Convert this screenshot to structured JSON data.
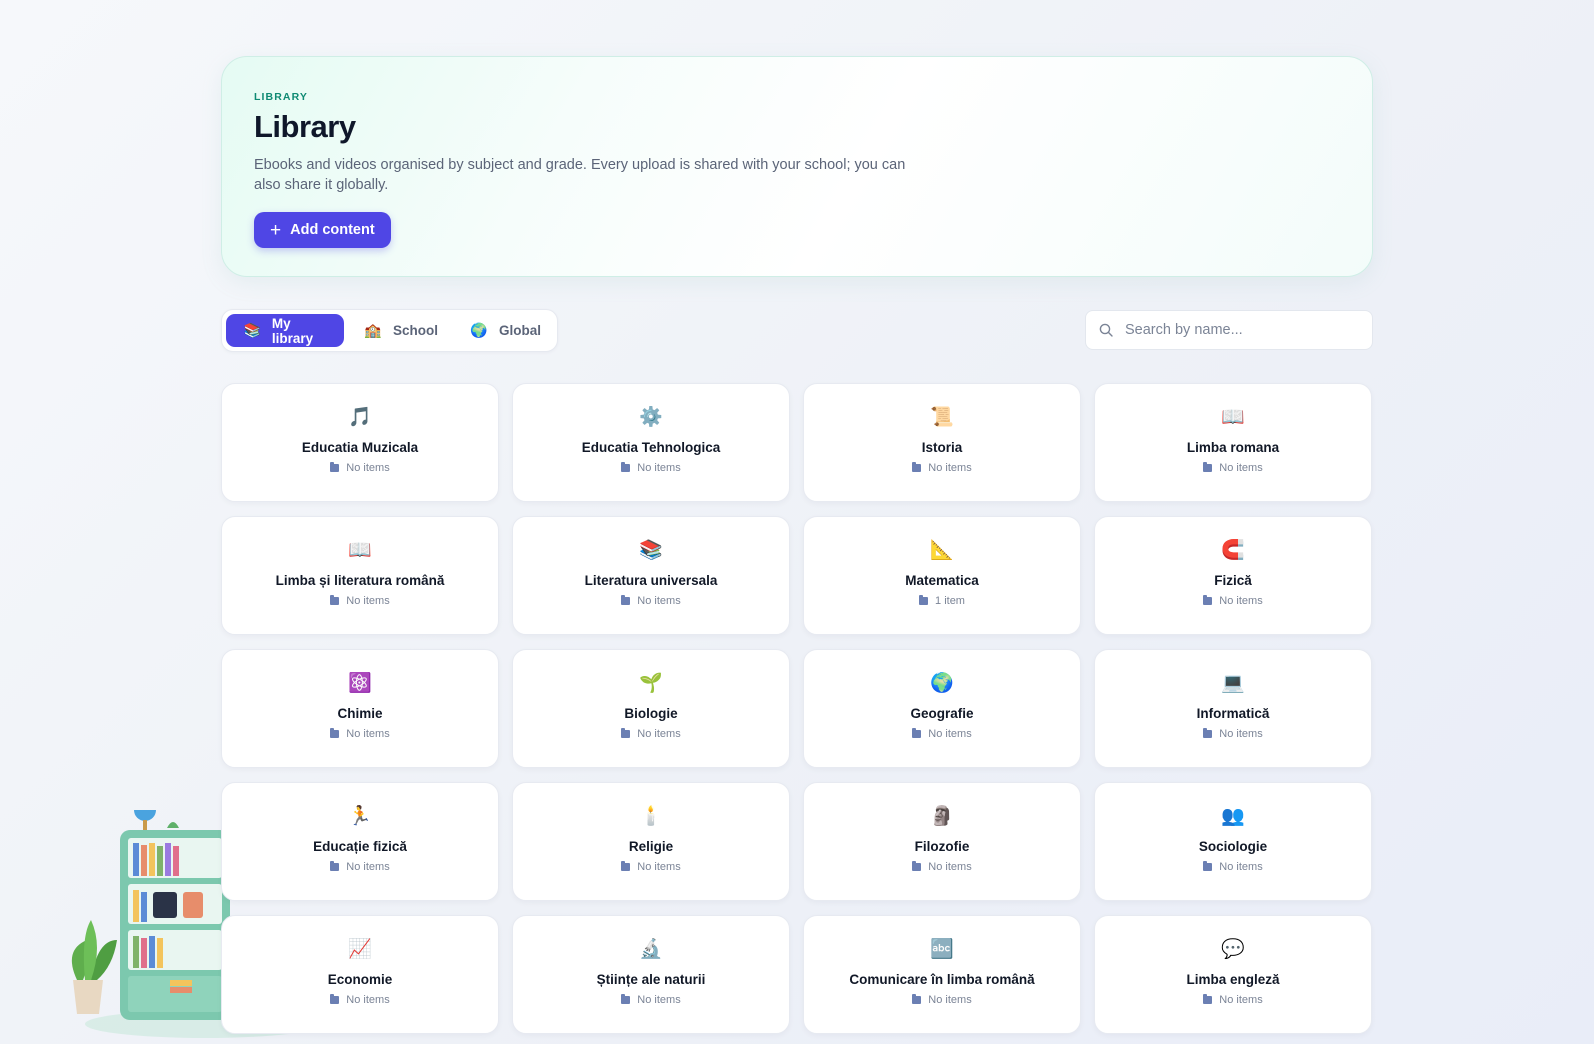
{
  "hero": {
    "eyebrow": "LIBRARY",
    "title": "Library",
    "description": "Ebooks and videos organised by subject and grade. Every upload is shared with your school; you can also share it globally.",
    "add_button": "Add content"
  },
  "tabs": [
    {
      "label": "My library",
      "icon": "books-icon",
      "active": true
    },
    {
      "label": "School",
      "icon": "school-icon",
      "active": false
    },
    {
      "label": "Global",
      "icon": "globe-icon",
      "active": false
    }
  ],
  "search": {
    "placeholder": "Search by name..."
  },
  "colors": {
    "accent": "#4f46e5",
    "eyebrow": "#0f8a73",
    "folder": "#6b7fb3"
  },
  "subjects": [
    {
      "name": "Educatia Muzicala",
      "count": "No items",
      "icon": "music-note-icon",
      "glyph": "🎵"
    },
    {
      "name": "Educatia Tehnologica",
      "count": "No items",
      "icon": "gear-icon",
      "glyph": "⚙️"
    },
    {
      "name": "Istoria",
      "count": "No items",
      "icon": "scroll-icon",
      "glyph": "📜"
    },
    {
      "name": "Limba romana",
      "count": "No items",
      "icon": "open-book-quill-icon",
      "glyph": "📖"
    },
    {
      "name": "Limba și literatura română",
      "count": "No items",
      "icon": "open-book-quill-icon",
      "glyph": "📖"
    },
    {
      "name": "Literatura universala",
      "count": "No items",
      "icon": "books-stack-icon",
      "glyph": "📚"
    },
    {
      "name": "Matematica",
      "count": "1 item",
      "icon": "triangle-ruler-icon",
      "glyph": "📐"
    },
    {
      "name": "Fizică",
      "count": "No items",
      "icon": "magnet-icon",
      "glyph": "🧲"
    },
    {
      "name": "Chimie",
      "count": "No items",
      "icon": "molecule-icon",
      "glyph": "⚛️"
    },
    {
      "name": "Biologie",
      "count": "No items",
      "icon": "seedling-icon",
      "glyph": "🌱"
    },
    {
      "name": "Geografie",
      "count": "No items",
      "icon": "globe-icon",
      "glyph": "🌍"
    },
    {
      "name": "Informatică",
      "count": "No items",
      "icon": "laptop-code-icon",
      "glyph": "💻"
    },
    {
      "name": "Educație fizică",
      "count": "No items",
      "icon": "running-icon",
      "glyph": "🏃"
    },
    {
      "name": "Religie",
      "count": "No items",
      "icon": "candle-icon",
      "glyph": "🕯️"
    },
    {
      "name": "Filozofie",
      "count": "No items",
      "icon": "bust-statue-icon",
      "glyph": "🗿"
    },
    {
      "name": "Sociologie",
      "count": "No items",
      "icon": "people-group-icon",
      "glyph": "👥"
    },
    {
      "name": "Economie",
      "count": "No items",
      "icon": "chart-up-icon",
      "glyph": "📈"
    },
    {
      "name": "Științe ale naturii",
      "count": "No items",
      "icon": "microscope-icon",
      "glyph": "🔬"
    },
    {
      "name": "Comunicare în limba română",
      "count": "No items",
      "icon": "alphabet-blocks-icon",
      "glyph": "🔤"
    },
    {
      "name": "Limba engleză",
      "count": "No items",
      "icon": "speech-bubble-icon",
      "glyph": "💬"
    }
  ]
}
